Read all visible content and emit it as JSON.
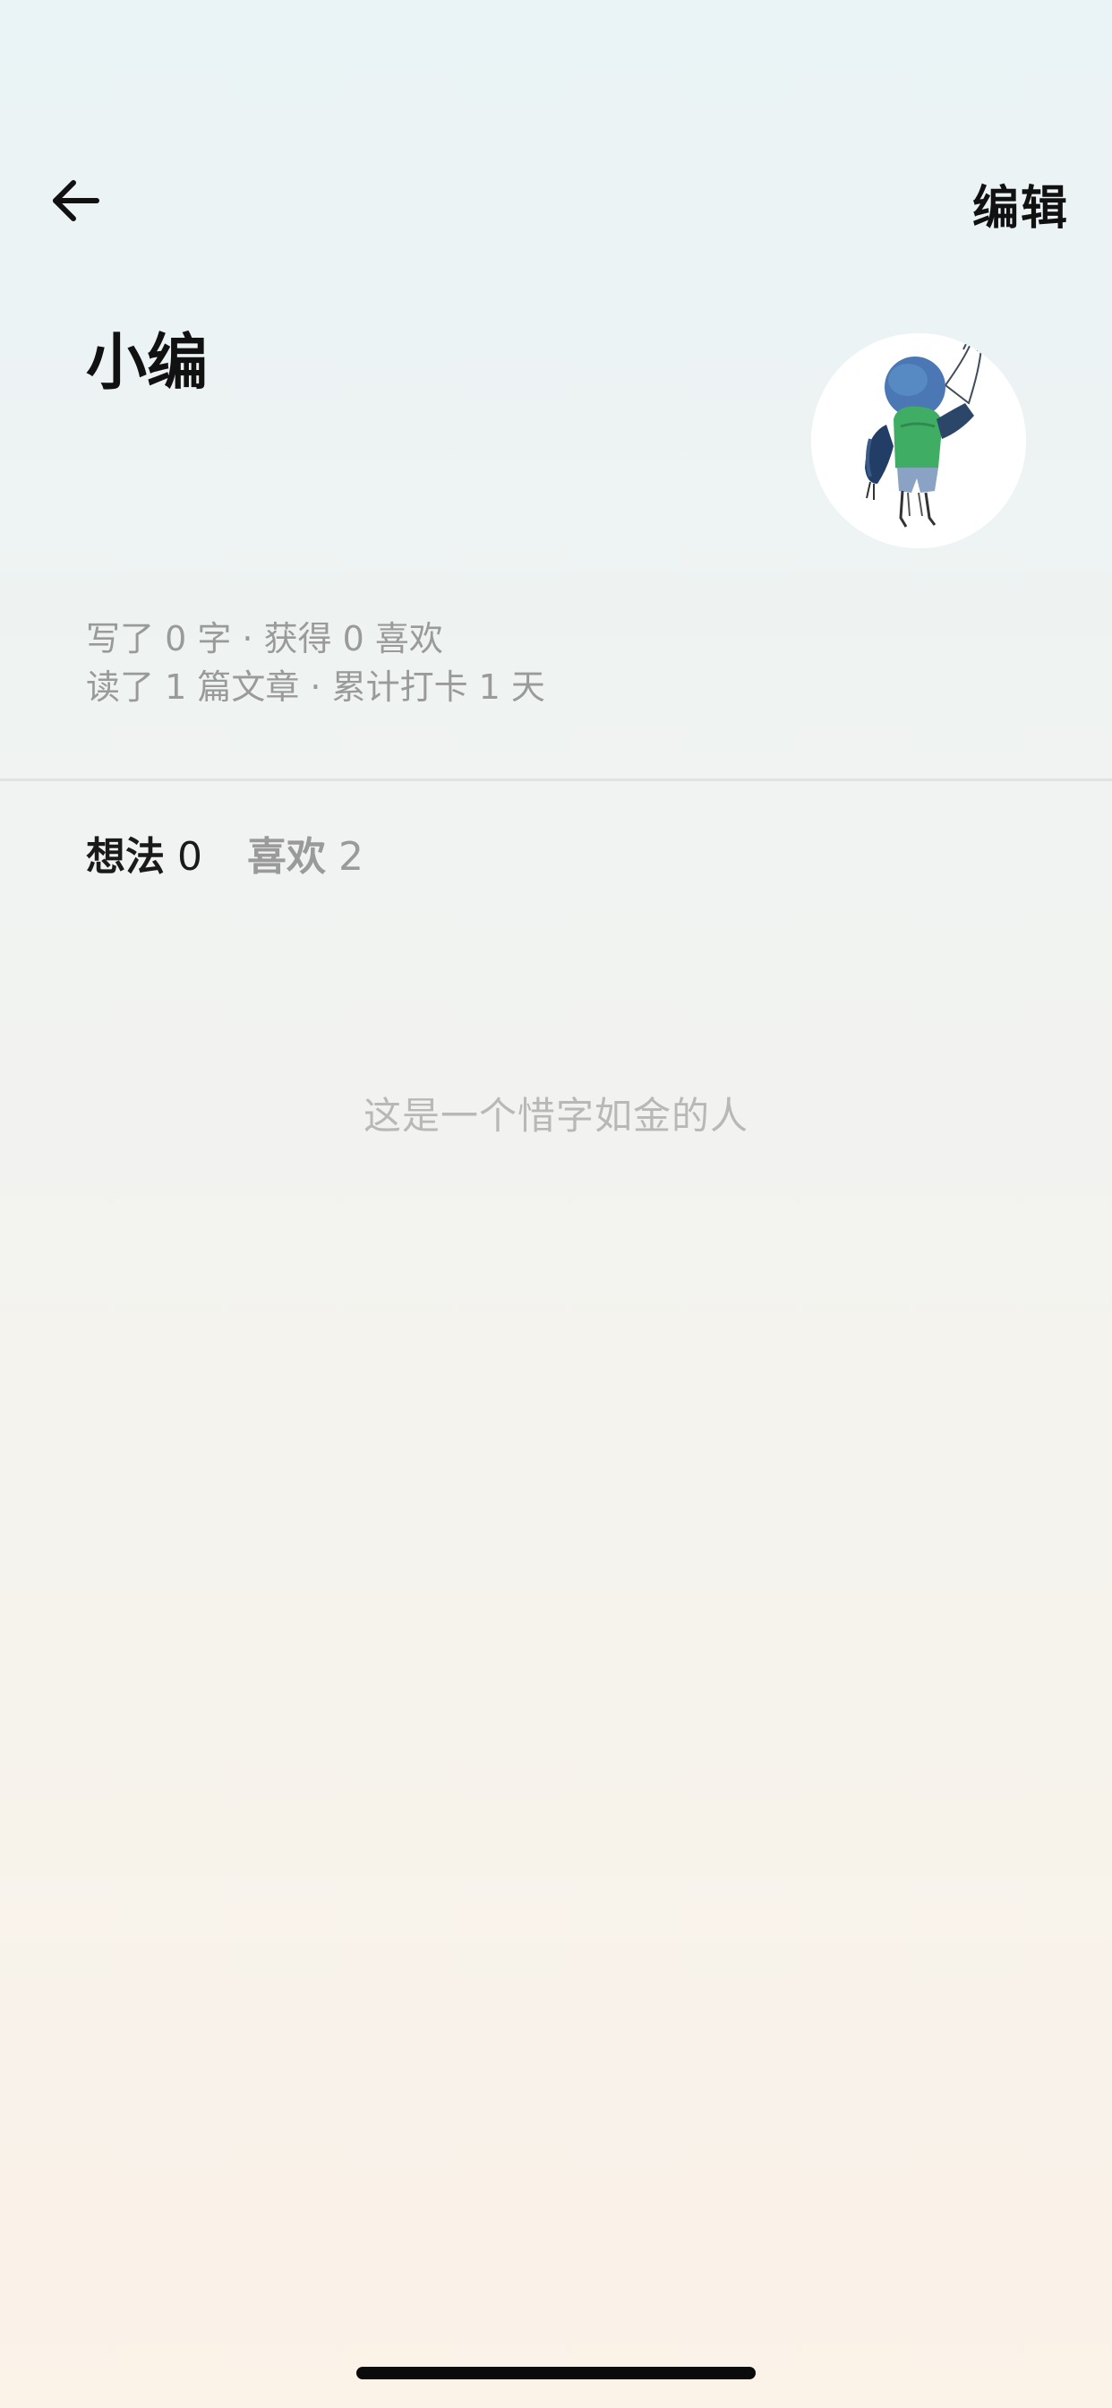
{
  "header": {
    "back_icon": "arrow-left-icon",
    "edit_label": "编辑"
  },
  "profile": {
    "name": "小编",
    "avatar_description_icon": "avatar-illustration",
    "stats": {
      "line1": "写了 0 字 · 获得 0 喜欢",
      "line2": "读了 1 篇文章 · 累计打卡 1 天"
    }
  },
  "tabs": [
    {
      "label": "想法",
      "count": "0",
      "active": true
    },
    {
      "label": "喜欢",
      "count": "2",
      "active": false
    }
  ],
  "empty_state": {
    "text": "这是一个惜字如金的人"
  },
  "colors": {
    "text_primary": "#111111",
    "text_secondary": "#9a9a9a",
    "empty_text": "#b8b8b8",
    "background_top": "#eaf3f5",
    "background_bottom": "#fbf2e8"
  }
}
